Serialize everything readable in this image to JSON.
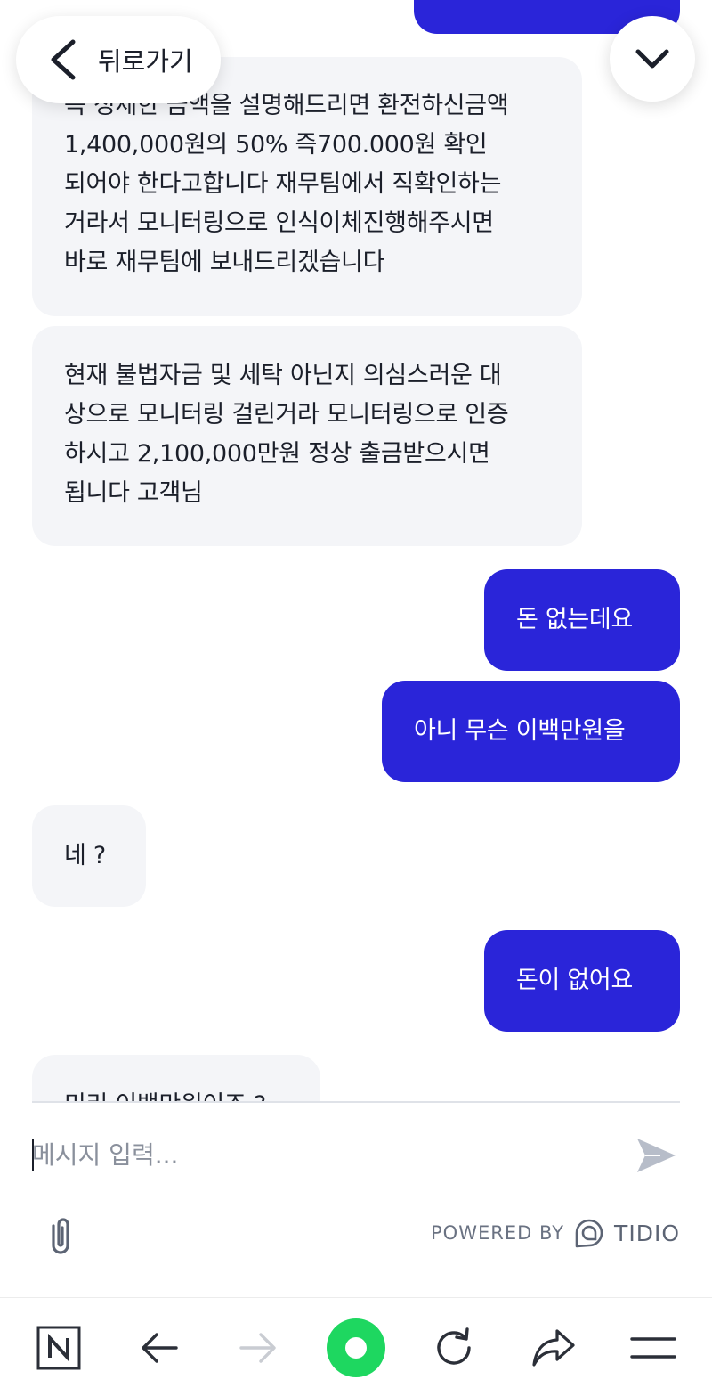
{
  "header": {
    "back_label": "뒤로가기"
  },
  "messages": [
    {
      "from": "visitor",
      "text": ""
    },
    {
      "from": "operator",
      "lines": [
        "즉 정세한 금액을 설명해드리면 환전하신금액",
        "1,400,000원의 50% 즉700.000원 확인",
        "되어야 한다고합니다 재무팀에서 직확인하는",
        "거라서 모니터링으로 인식이체진행해주시면",
        "바로 재무팀에 보내드리겠습니다"
      ]
    },
    {
      "from": "operator",
      "lines": [
        "현재 불법자금 및 세탁 아닌지 의심스러운 대",
        "상으로 모니터링 걸린거라 모니터링으로 인증",
        "하시고 2,100,000만원 정상 출금받으시면",
        "됩니다 고객님"
      ]
    },
    {
      "from": "visitor",
      "text": "돈 없는데요"
    },
    {
      "from": "visitor",
      "text": "아니 무슨 이백만원을"
    },
    {
      "from": "operator",
      "text": "네 ?"
    },
    {
      "from": "visitor",
      "text": "돈이 없어요"
    },
    {
      "from": "operator",
      "text": "미리 이백만원이죠 ?"
    }
  ],
  "composer": {
    "placeholder": "메시지 입력...",
    "powered_by": "POWERED BY",
    "brand": "TIDIO"
  },
  "icons": {
    "back": "chevron-left-icon",
    "scroll_down": "chevron-down-icon",
    "send": "send-icon",
    "attach": "paperclip-icon",
    "brand_logo": "tidio-logo-icon",
    "nav": [
      "naver-n-icon",
      "arrow-left-icon",
      "arrow-right-icon",
      "green-home-button-icon",
      "refresh-icon",
      "share-icon",
      "menu-icon"
    ]
  },
  "colors": {
    "visitor_bubble": "#2a25d9",
    "operator_bubble": "#f4f5f8",
    "nav_green": "#1ed760"
  }
}
